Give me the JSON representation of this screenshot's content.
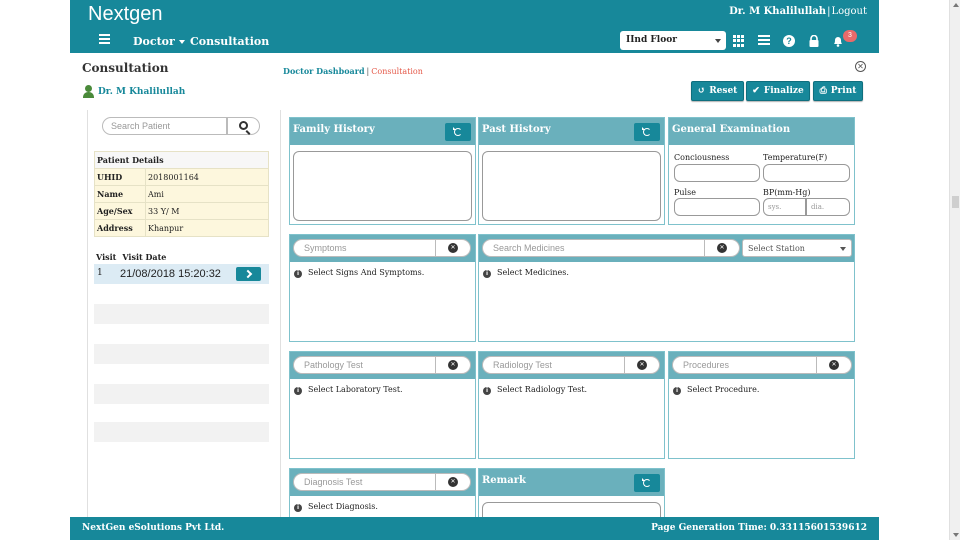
{
  "header": {
    "brand": "Nextgen",
    "user_name": "Dr. M Khalilullah",
    "logout_label": "Logout",
    "nav": [
      {
        "label": "Doctor"
      },
      {
        "label": "Consultation"
      }
    ],
    "floor_selected": "IInd Floor",
    "notification_count": "3",
    "icons": [
      "menu-icon",
      "apps-grid-icon",
      "list-icon",
      "help-icon",
      "lock-icon",
      "bell-icon"
    ]
  },
  "page": {
    "title": "Consultation",
    "breadcrumb": {
      "parent": "Doctor Dashboard",
      "separator": "|",
      "current": "Consultation"
    },
    "doctor": "Dr. M Khalilullah",
    "actions": {
      "reset": "Reset",
      "finalize": "Finalize",
      "print": "Print"
    }
  },
  "patient_search": {
    "placeholder": "Search Patient"
  },
  "patient_details": {
    "heading": "Patient Details",
    "rows": [
      {
        "label": "UHID",
        "value": "2018001164"
      },
      {
        "label": "Name",
        "value": "Ami"
      },
      {
        "label": "Age/Sex",
        "value": "33 Y/ M"
      },
      {
        "label": "Address",
        "value": "Khanpur"
      }
    ]
  },
  "visits": {
    "col_visit": "Visit",
    "col_date": "Visit Date",
    "rows": [
      {
        "no": "1",
        "date": "21/08/2018 15:20:32"
      }
    ]
  },
  "panels": {
    "family_history": {
      "title": "Family History"
    },
    "past_history": {
      "title": "Past History"
    },
    "general_exam": {
      "title": "General Examination",
      "consciousness": "Conciousness",
      "temperature": "Temperature(F)",
      "pulse": "Pulse",
      "bp": "BP(mm-Hg)",
      "bp_sys": "sys.",
      "bp_dia": "dia."
    },
    "symptoms": {
      "placeholder": "Symptoms",
      "hint": "Select Signs And Symptoms."
    },
    "medicines": {
      "placeholder": "Search Medicines",
      "station": "Select Station",
      "hint": "Select Medicines."
    },
    "pathology": {
      "placeholder": "Pathology Test",
      "hint": "Select Laboratory Test."
    },
    "radiology": {
      "placeholder": "Radiology Test",
      "hint": "Select Radiology Test."
    },
    "procedures": {
      "placeholder": "Procedures",
      "hint": "Select Procedure."
    },
    "diagnosis": {
      "placeholder": "Diagnosis Test",
      "hint": "Select Diagnosis."
    },
    "remark": {
      "title": "Remark"
    }
  },
  "footer": {
    "company": "NextGen eSolutions Pvt Ltd.",
    "generation_time": "Page Generation Time: 0.33115601539612"
  },
  "colors": {
    "primary": "#17889a",
    "panel_header": "#6ab0bc",
    "breadcrumb_current": "#e55a4a",
    "badge": "#e96a6a"
  }
}
